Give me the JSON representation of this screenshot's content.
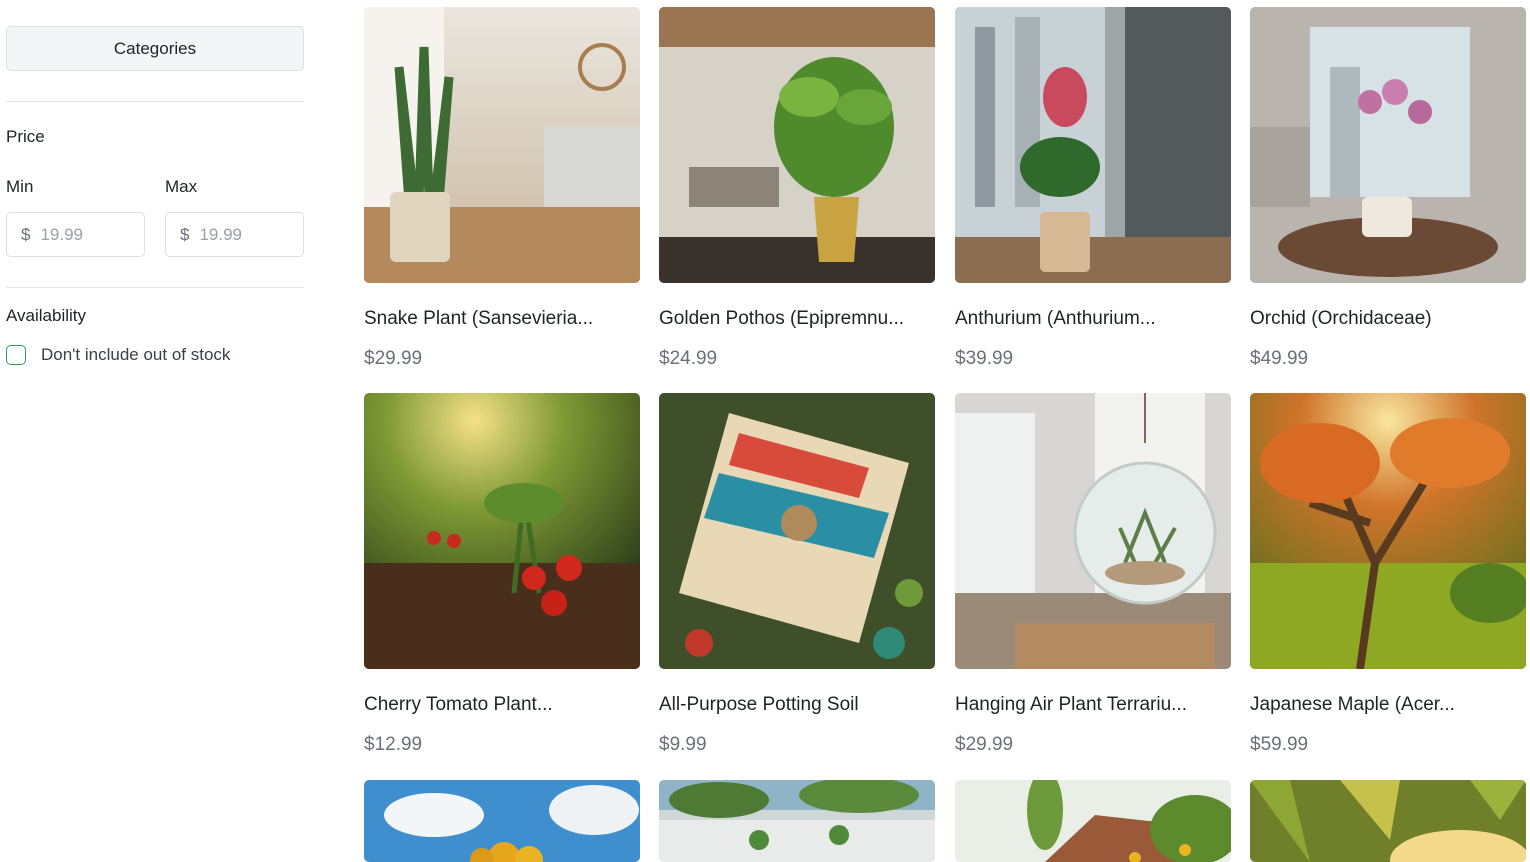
{
  "sidebar": {
    "categories_label": "Categories",
    "price_title": "Price",
    "min_label": "Min",
    "max_label": "Max",
    "currency_symbol": "$",
    "min_placeholder": "19.99",
    "max_placeholder": "19.99",
    "availability_title": "Availability",
    "out_of_stock_label": "Don't include out of stock",
    "out_of_stock_checked": false
  },
  "products": [
    {
      "name": "Snake Plant (Sansevieria...",
      "price": "$29.99"
    },
    {
      "name": "Golden Pothos (Epipremnu...",
      "price": "$24.99"
    },
    {
      "name": "Anthurium (Anthurium...",
      "price": "$39.99"
    },
    {
      "name": "Orchid (Orchidaceae)",
      "price": "$49.99"
    },
    {
      "name": "Cherry Tomato Plant...",
      "price": "$12.99"
    },
    {
      "name": "All-Purpose Potting Soil",
      "price": "$9.99"
    },
    {
      "name": "Hanging Air Plant Terrariu...",
      "price": "$29.99"
    },
    {
      "name": "Japanese Maple (Acer...",
      "price": "$59.99"
    }
  ],
  "colors": {
    "checkbox_border": "#2f9e5b",
    "price_text": "#6b7078"
  }
}
